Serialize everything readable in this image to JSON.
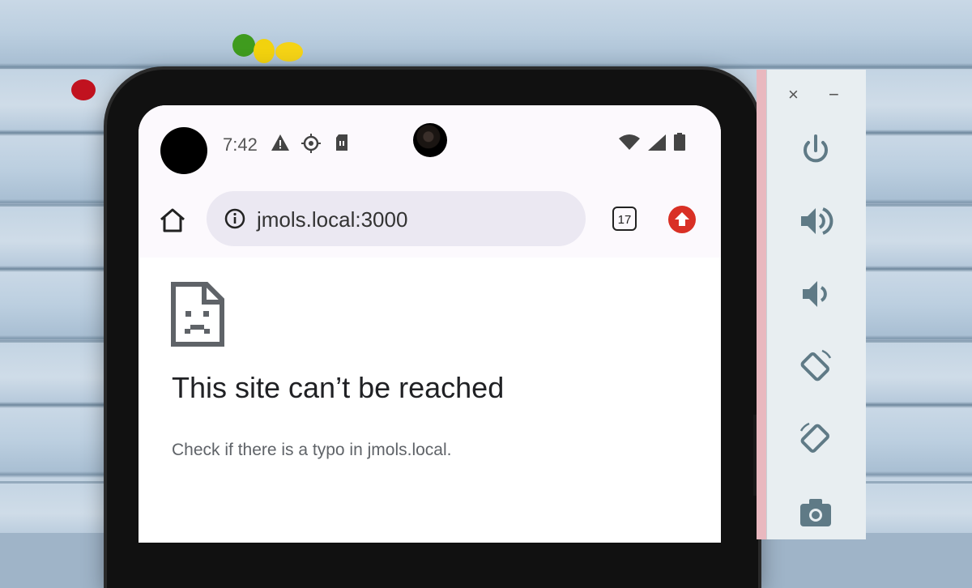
{
  "status_bar": {
    "time": "7:42",
    "left_icons": [
      "warning-icon",
      "crosshair-icon",
      "sim-card-icon"
    ],
    "right_icons": [
      "wifi-icon",
      "signal-icon",
      "battery-icon"
    ]
  },
  "browser": {
    "url": "jmols.local:3000",
    "tab_count": "17"
  },
  "error_page": {
    "title": "This site can’t be reached",
    "description": "Check if there is a typo in jmols.local."
  },
  "emulator_panel": {
    "close_label": "×",
    "minimize_label": "−",
    "buttons": [
      "power-icon",
      "volume-up-icon",
      "volume-down-icon",
      "rotate-left-icon",
      "rotate-right-icon",
      "camera-icon"
    ]
  },
  "colors": {
    "error_red": "#d93025",
    "panel_icon": "#5f7a86"
  }
}
